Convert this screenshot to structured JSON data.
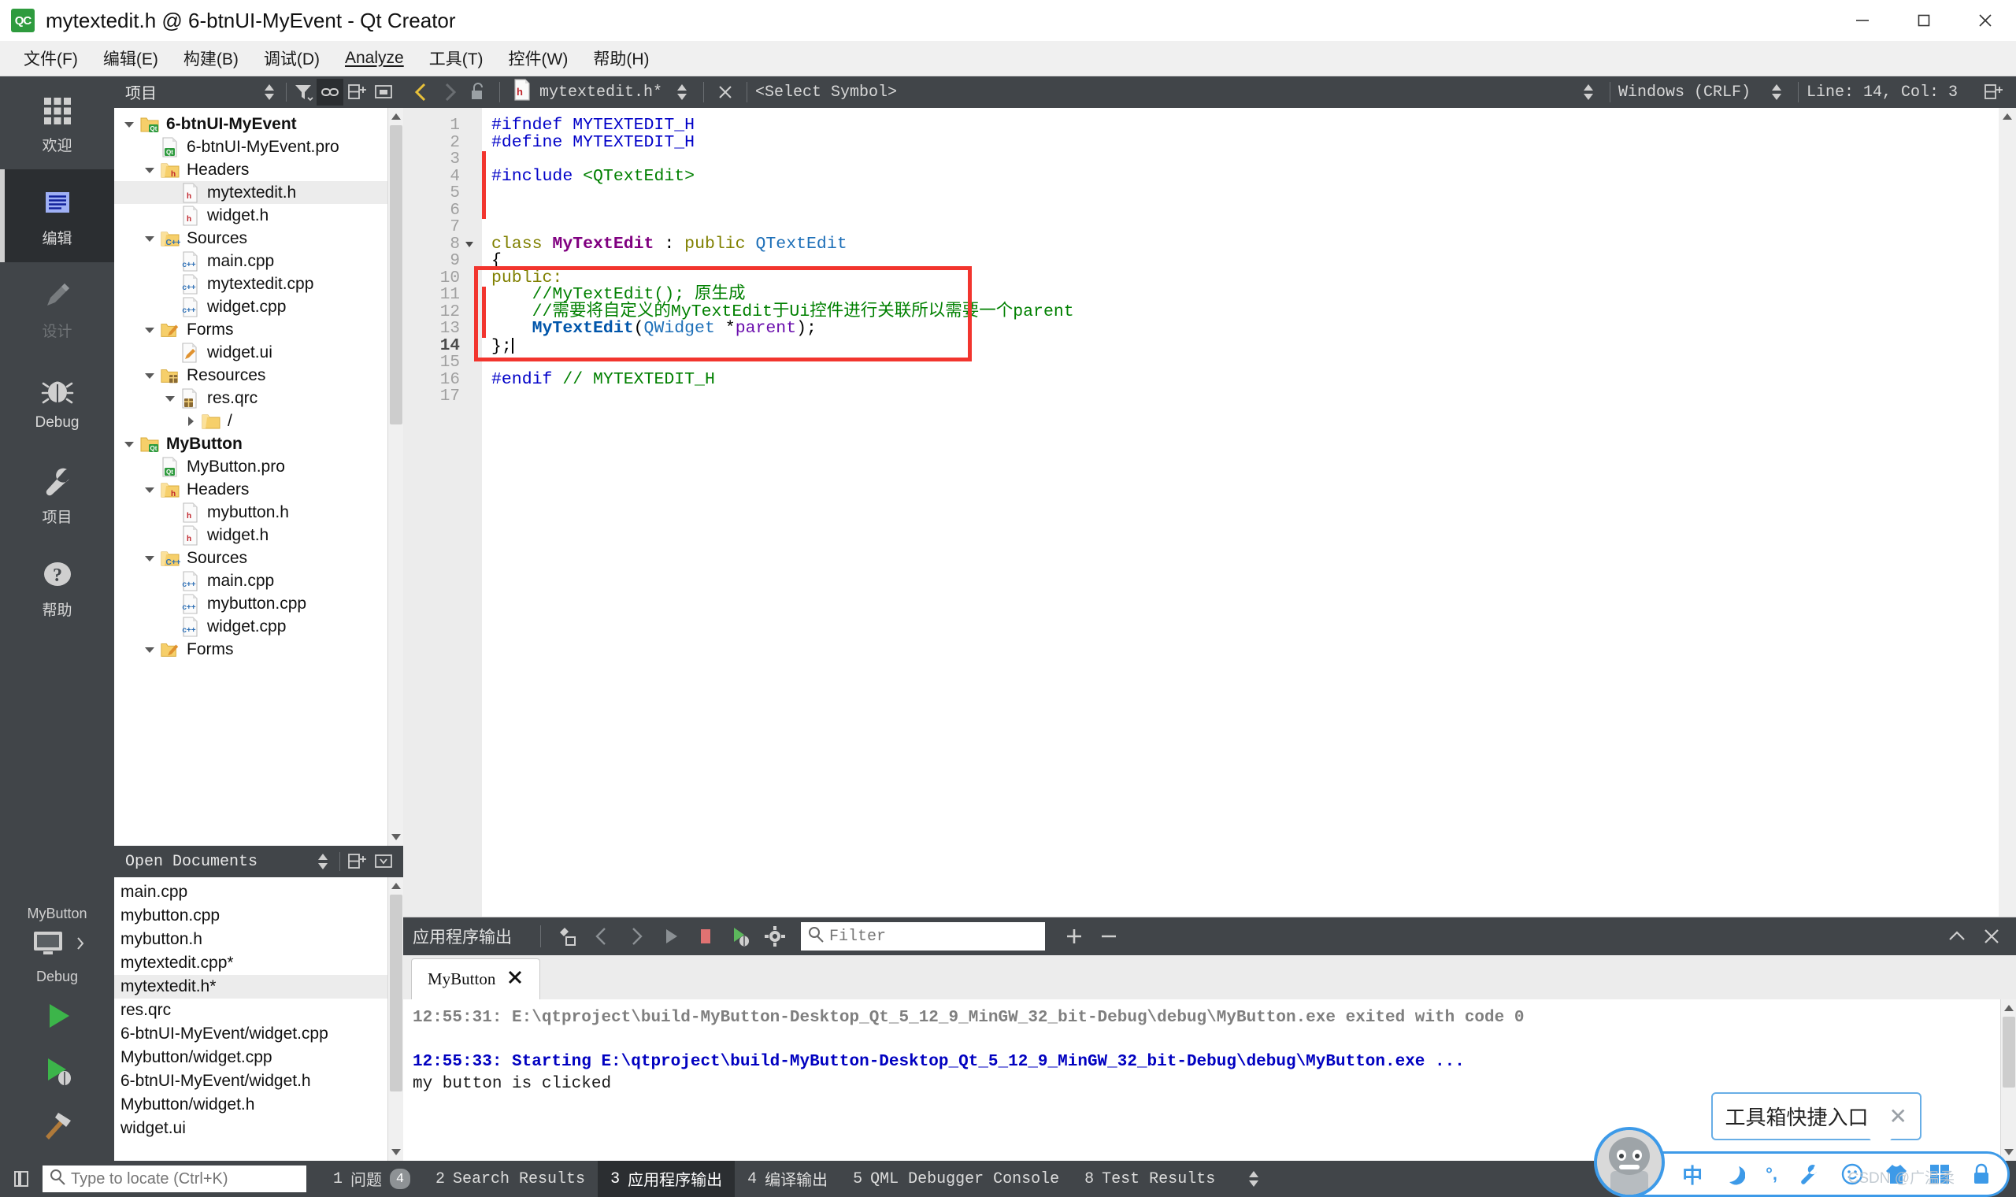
{
  "window": {
    "title": "mytextedit.h @ 6-btnUI-MyEvent - Qt Creator",
    "logo_text": "QC",
    "minimize": "minimize-icon",
    "maximize": "maximize-icon",
    "close": "close-icon"
  },
  "menubar": [
    {
      "label": "文件(F)",
      "mnemonic": "F"
    },
    {
      "label": "编辑(E)",
      "mnemonic": "E"
    },
    {
      "label": "构建(B)",
      "mnemonic": "B"
    },
    {
      "label": "调试(D)",
      "mnemonic": "D"
    },
    {
      "label": "Analyze",
      "mnemonic": "A"
    },
    {
      "label": "工具(T)",
      "mnemonic": "T"
    },
    {
      "label": "控件(W)",
      "mnemonic": "W"
    },
    {
      "label": "帮助(H)",
      "mnemonic": "H"
    }
  ],
  "modebar": {
    "items": [
      {
        "label": "欢迎",
        "icon": "grid-icon",
        "state": "normal"
      },
      {
        "label": "编辑",
        "icon": "edit-lines-icon",
        "state": "active"
      },
      {
        "label": "设计",
        "icon": "pencil-icon",
        "state": "disabled"
      },
      {
        "label": "Debug",
        "icon": "bug-icon",
        "state": "normal"
      },
      {
        "label": "项目",
        "icon": "wrench-icon",
        "state": "normal"
      },
      {
        "label": "帮助",
        "icon": "question-icon",
        "state": "normal"
      }
    ],
    "kit": {
      "project": "MyButton",
      "build_config": "Debug",
      "icon": "monitor-icon",
      "arrow": "chevron-right-icon"
    },
    "run_buttons": [
      {
        "name": "run-button",
        "icon": "play-icon"
      },
      {
        "name": "debug-button",
        "icon": "play-bug-icon"
      },
      {
        "name": "build-button",
        "icon": "hammer-icon"
      }
    ]
  },
  "project_panel": {
    "header": {
      "title": "项目",
      "buttons": [
        "sort-selector-icon",
        "filter-icon",
        "link-icon",
        "split-icon",
        "close-panel-icon"
      ]
    },
    "tree": [
      {
        "depth": 0,
        "twisty": "down",
        "icon": "folder-qt",
        "label": "6-btnUI-MyEvent",
        "bold": true,
        "selected": false
      },
      {
        "depth": 1,
        "twisty": "none",
        "icon": "file-qt",
        "label": "6-btnUI-MyEvent.pro",
        "bold": false,
        "selected": false
      },
      {
        "depth": 1,
        "twisty": "down",
        "icon": "folder-h",
        "label": "Headers",
        "bold": false,
        "selected": false
      },
      {
        "depth": 2,
        "twisty": "none",
        "icon": "file-h",
        "label": "mytextedit.h",
        "bold": false,
        "selected": true
      },
      {
        "depth": 2,
        "twisty": "none",
        "icon": "file-h",
        "label": "widget.h",
        "bold": false,
        "selected": false
      },
      {
        "depth": 1,
        "twisty": "down",
        "icon": "folder-cpp",
        "label": "Sources",
        "bold": false,
        "selected": false
      },
      {
        "depth": 2,
        "twisty": "none",
        "icon": "file-cpp",
        "label": "main.cpp",
        "bold": false,
        "selected": false
      },
      {
        "depth": 2,
        "twisty": "none",
        "icon": "file-cpp",
        "label": "mytextedit.cpp",
        "bold": false,
        "selected": false
      },
      {
        "depth": 2,
        "twisty": "none",
        "icon": "file-cpp",
        "label": "widget.cpp",
        "bold": false,
        "selected": false
      },
      {
        "depth": 1,
        "twisty": "down",
        "icon": "folder-ui",
        "label": "Forms",
        "bold": false,
        "selected": false
      },
      {
        "depth": 2,
        "twisty": "none",
        "icon": "file-ui",
        "label": "widget.ui",
        "bold": false,
        "selected": false
      },
      {
        "depth": 1,
        "twisty": "down",
        "icon": "folder-qrc",
        "label": "Resources",
        "bold": false,
        "selected": false
      },
      {
        "depth": 2,
        "twisty": "down",
        "icon": "file-qrc",
        "label": "res.qrc",
        "bold": false,
        "selected": false
      },
      {
        "depth": 3,
        "twisty": "right",
        "icon": "folder-plain",
        "label": "/",
        "bold": false,
        "selected": false
      },
      {
        "depth": 0,
        "twisty": "down",
        "icon": "folder-qt",
        "label": "MyButton",
        "bold": true,
        "selected": false
      },
      {
        "depth": 1,
        "twisty": "none",
        "icon": "file-qt",
        "label": "MyButton.pro",
        "bold": false,
        "selected": false
      },
      {
        "depth": 1,
        "twisty": "down",
        "icon": "folder-h",
        "label": "Headers",
        "bold": false,
        "selected": false
      },
      {
        "depth": 2,
        "twisty": "none",
        "icon": "file-h",
        "label": "mybutton.h",
        "bold": false,
        "selected": false
      },
      {
        "depth": 2,
        "twisty": "none",
        "icon": "file-h",
        "label": "widget.h",
        "bold": false,
        "selected": false
      },
      {
        "depth": 1,
        "twisty": "down",
        "icon": "folder-cpp",
        "label": "Sources",
        "bold": false,
        "selected": false
      },
      {
        "depth": 2,
        "twisty": "none",
        "icon": "file-cpp",
        "label": "main.cpp",
        "bold": false,
        "selected": false
      },
      {
        "depth": 2,
        "twisty": "none",
        "icon": "file-cpp",
        "label": "mybutton.cpp",
        "bold": false,
        "selected": false
      },
      {
        "depth": 2,
        "twisty": "none",
        "icon": "file-cpp",
        "label": "widget.cpp",
        "bold": false,
        "selected": false
      },
      {
        "depth": 1,
        "twisty": "down",
        "icon": "folder-ui",
        "label": "Forms",
        "bold": false,
        "selected": false
      }
    ]
  },
  "open_documents": {
    "header": {
      "title": "Open Documents",
      "buttons": [
        "sort-selector-icon",
        "split-icon",
        "close-panel-icon"
      ]
    },
    "items": [
      {
        "label": "main.cpp",
        "selected": false
      },
      {
        "label": "mybutton.cpp",
        "selected": false
      },
      {
        "label": "mybutton.h",
        "selected": false
      },
      {
        "label": "mytextedit.cpp*",
        "selected": false
      },
      {
        "label": "mytextedit.h*",
        "selected": true
      },
      {
        "label": "res.qrc",
        "selected": false
      },
      {
        "label": "6-btnUI-MyEvent/widget.cpp",
        "selected": false
      },
      {
        "label": "Mybutton/widget.cpp",
        "selected": false
      },
      {
        "label": "6-btnUI-MyEvent/widget.h",
        "selected": false
      },
      {
        "label": "Mybutton/widget.h",
        "selected": false
      },
      {
        "label": "widget.ui",
        "selected": false
      }
    ]
  },
  "editor_toolbar": {
    "back_icon": "chevron-left-icon",
    "forward_icon": "chevron-right-icon",
    "lock_icon": "unlock-icon",
    "file_icon": "file-h-icon",
    "file_name": "mytextedit.h*",
    "file_selector_icon": "updown-selector-icon",
    "close_icon": "close-x-icon",
    "symbol_label": "<Select Symbol>",
    "symbol_selector_icon": "updown-selector-icon",
    "line_ending": "Windows (CRLF)",
    "line_ending_selector_icon": "updown-selector-icon",
    "cursor_position": "Line: 14, Col: 3",
    "split_icon": "split-icon"
  },
  "editor": {
    "lines": [
      {
        "n": 1,
        "segments": [
          {
            "t": "#ifndef MYTEXTEDIT_H",
            "c": "tok-pre"
          }
        ]
      },
      {
        "n": 2,
        "segments": [
          {
            "t": "#define MYTEXTEDIT_H",
            "c": "tok-pre"
          }
        ]
      },
      {
        "n": 3,
        "segments": []
      },
      {
        "n": 4,
        "segments": [
          {
            "t": "#include ",
            "c": "tok-pre"
          },
          {
            "t": "<QTextEdit>",
            "c": "tok-str"
          }
        ]
      },
      {
        "n": 5,
        "segments": []
      },
      {
        "n": 6,
        "segments": []
      },
      {
        "n": 7,
        "segments": []
      },
      {
        "n": 8,
        "segments": [
          {
            "t": "class ",
            "c": "tok-kw"
          },
          {
            "t": "MyTextEdit",
            "c": "tok-type"
          },
          {
            "t": " : ",
            "c": "tok-op"
          },
          {
            "t": "public ",
            "c": "tok-kw"
          },
          {
            "t": "QTextEdit",
            "c": "tok-cls"
          }
        ],
        "fold": true
      },
      {
        "n": 9,
        "segments": [
          {
            "t": "{",
            "c": "tok-op"
          }
        ]
      },
      {
        "n": 10,
        "segments": [
          {
            "t": "public:",
            "c": "tok-kw"
          }
        ]
      },
      {
        "n": 11,
        "segments": [
          {
            "t": "    //MyTextEdit(); 原生成",
            "c": "tok-cmt"
          }
        ]
      },
      {
        "n": 12,
        "segments": [
          {
            "t": "    //需要将自定义的MyTextEdit于Ui控件进行关联所以需要一个parent",
            "c": "tok-cmt"
          }
        ]
      },
      {
        "n": 13,
        "segments": [
          {
            "t": "    ",
            "c": "tok-op"
          },
          {
            "t": "MyTextEdit",
            "c": "tok-fn"
          },
          {
            "t": "(",
            "c": "tok-op"
          },
          {
            "t": "QWidget",
            "c": "tok-cls"
          },
          {
            "t": " *",
            "c": "tok-op"
          },
          {
            "t": "parent",
            "c": "tok-var"
          },
          {
            "t": ");",
            "c": "tok-op"
          }
        ]
      },
      {
        "n": 14,
        "segments": [
          {
            "t": "};",
            "c": "tok-op"
          }
        ],
        "caret": true,
        "current": true
      },
      {
        "n": 15,
        "segments": []
      },
      {
        "n": 16,
        "segments": [
          {
            "t": "#endif ",
            "c": "tok-pre"
          },
          {
            "t": "// MYTEXTEDIT_H",
            "c": "tok-cmt"
          }
        ]
      },
      {
        "n": 17,
        "segments": []
      }
    ],
    "change_bars": [
      {
        "from_line": 3,
        "to_line": 6
      },
      {
        "from_line": 11,
        "to_line": 13
      }
    ],
    "highlight_box": {
      "from_line": 10,
      "to_line": 14,
      "color": "#f2352e"
    }
  },
  "output_pane": {
    "title": "应用程序输出",
    "buttons": [
      "clear-icon",
      "prev-item-icon",
      "next-item-icon",
      "play-icon",
      "stop-icon",
      "debug-run-icon",
      "settings-gear-icon"
    ],
    "filter_placeholder": "Filter",
    "filter_value": "",
    "add_icon": "plus-icon",
    "remove_icon": "minus-icon",
    "collapse_icon": "chevron-up-icon",
    "close_icon": "close-x-icon",
    "tab": {
      "label": "MyButton",
      "close_icon": "close-x-icon"
    },
    "lines": [
      {
        "text": "12:55:31: E:\\qtproject\\build-MyButton-Desktop_Qt_5_12_9_MinGW_32_bit-Debug\\debug\\MyButton.exe exited with code 0",
        "style": "gray"
      },
      {
        "text": "",
        "style": "plain"
      },
      {
        "text": "12:55:33: Starting E:\\qtproject\\build-MyButton-Desktop_Qt_5_12_9_MinGW_32_bit-Debug\\debug\\MyButton.exe ...",
        "style": "blue"
      },
      {
        "text": "my button is clicked",
        "style": "plain"
      }
    ]
  },
  "statusbar": {
    "toggle_sidebar_icon": "toggle-sidebar-icon",
    "locator_placeholder": "Type to locate (Ctrl+K)",
    "locator_value": "",
    "locator_icon": "search-icon",
    "tabs": [
      {
        "num": "1",
        "label": "问题",
        "badge": "4",
        "active": false
      },
      {
        "num": "2",
        "label": "Search Results",
        "badge": "",
        "active": false
      },
      {
        "num": "3",
        "label": "应用程序输出",
        "badge": "",
        "active": true
      },
      {
        "num": "4",
        "label": "编译输出",
        "badge": "",
        "active": false
      },
      {
        "num": "5",
        "label": "QML Debugger Console",
        "badge": "",
        "active": false
      },
      {
        "num": "8",
        "label": "Test Results",
        "badge": "",
        "active": false
      }
    ],
    "more_icon": "updown-selector-icon"
  },
  "ime_toolbar": {
    "tooltip_text": "工具箱快捷入口",
    "tooltip_close_icon": "close-x-icon",
    "watermark": "CSDN @广温柔",
    "items": [
      {
        "icon": "chinese-mode-icon",
        "label": "中"
      },
      {
        "icon": "moon-icon",
        "label": ""
      },
      {
        "icon": "punctuation-icon",
        "label": "°,"
      },
      {
        "icon": "wrench-icon",
        "label": ""
      },
      {
        "icon": "smiley-icon",
        "label": ""
      },
      {
        "icon": "skin-icon",
        "label": ""
      },
      {
        "icon": "toolbox-icon",
        "label": ""
      },
      {
        "icon": "lock-icon",
        "label": ""
      }
    ]
  },
  "colors": {
    "dark_chrome": "#414549",
    "dark_active": "#2b2e31",
    "accent_red": "#f2352e",
    "qt_green": "#2e9b3e",
    "ime_blue": "#3d9ae8"
  }
}
